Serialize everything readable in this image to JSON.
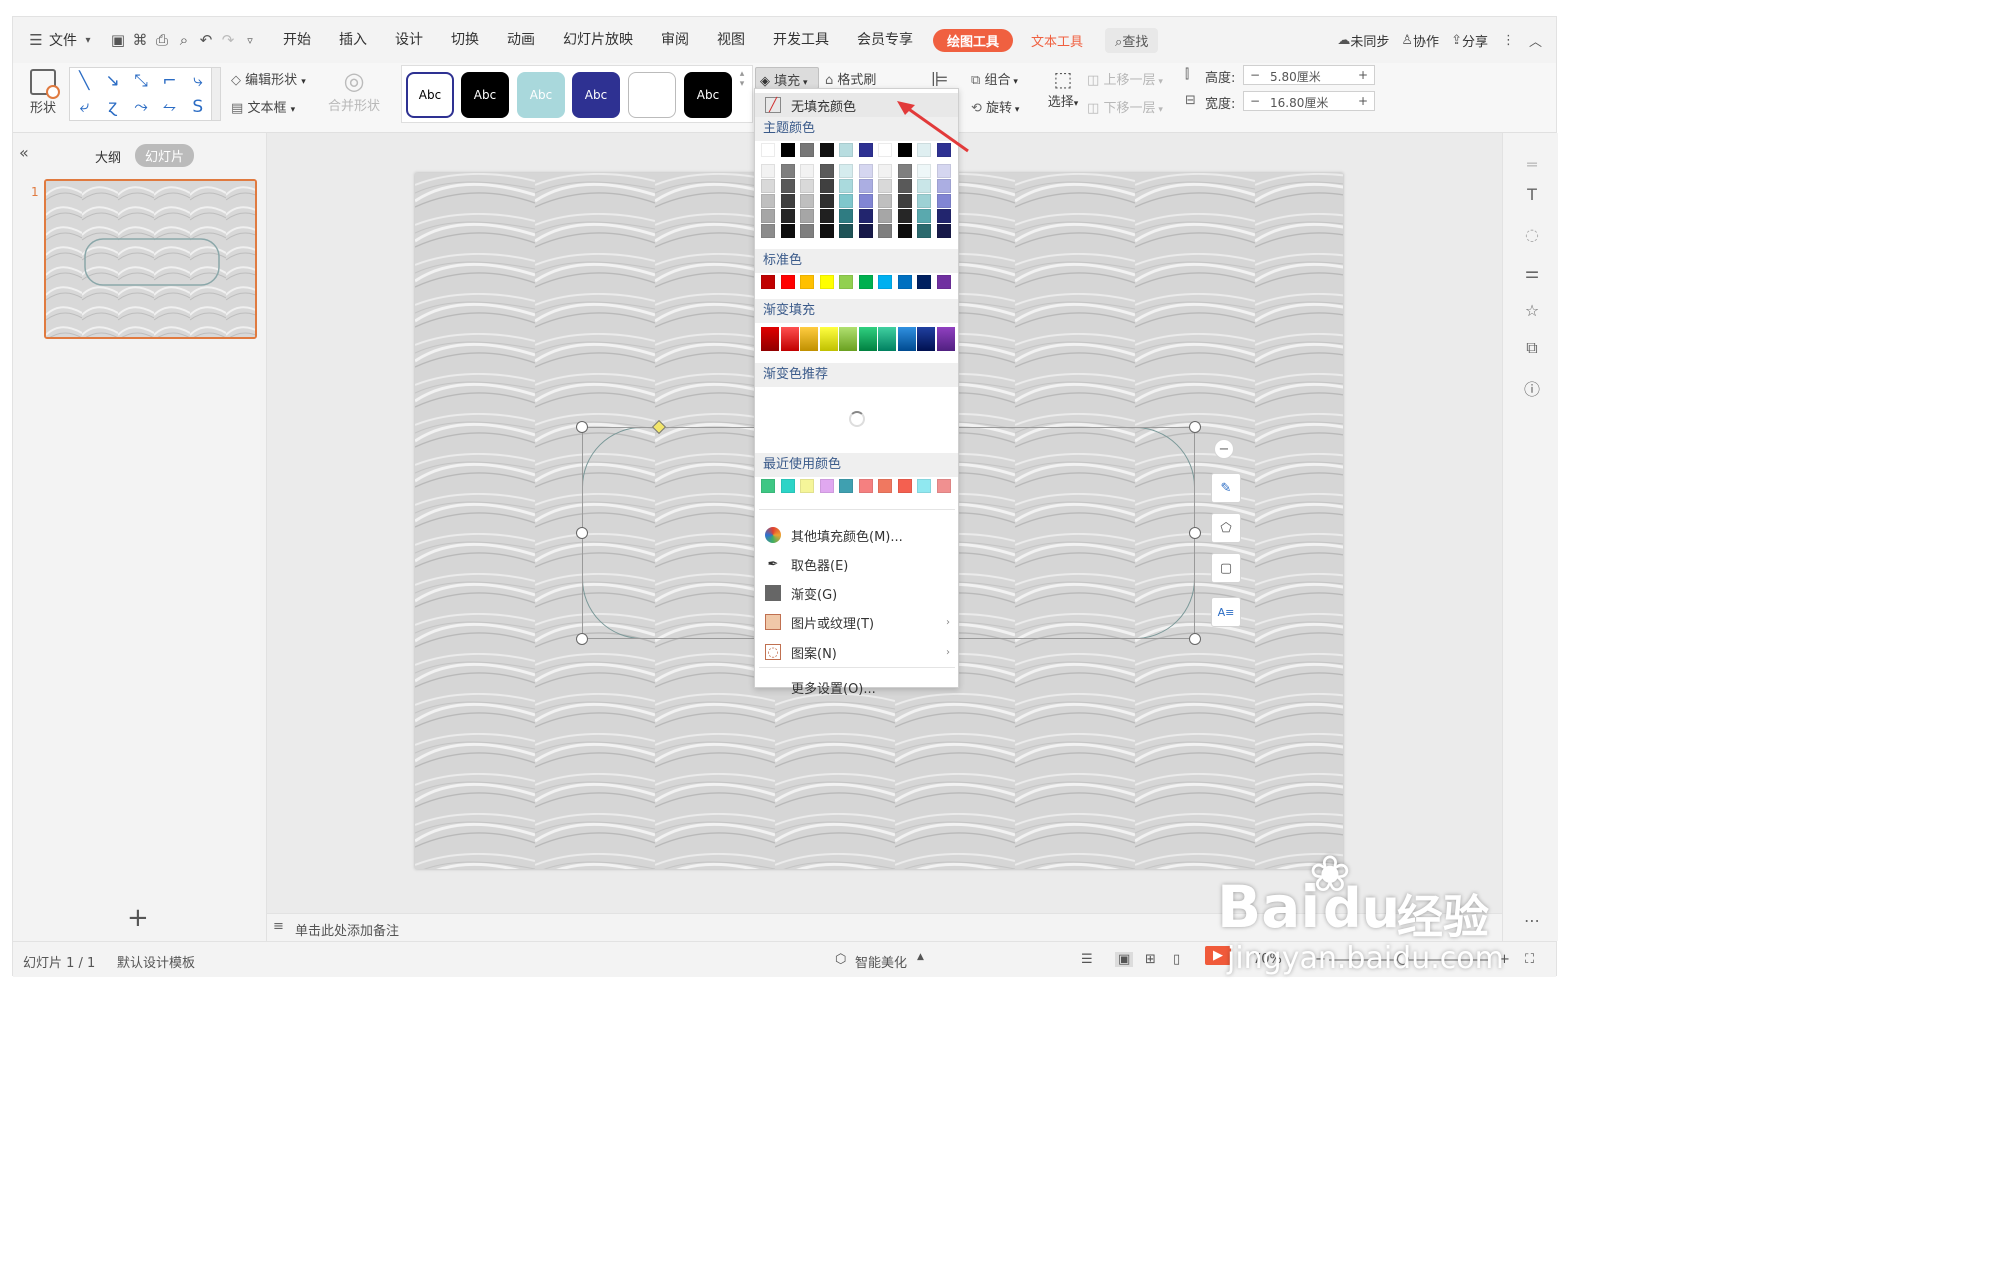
{
  "menubar": {
    "file": "文件",
    "tabs": [
      "开始",
      "插入",
      "设计",
      "切换",
      "动画",
      "幻灯片放映",
      "审阅",
      "视图",
      "开发工具",
      "会员专享"
    ],
    "drawing_tools": "绘图工具",
    "text_tools": "文本工具",
    "search": "查找",
    "sync": "未同步",
    "collab": "协作",
    "share": "分享"
  },
  "ribbon": {
    "shape": "形状",
    "edit_shape": "编辑形状",
    "text_box": "文本框",
    "merge_shapes": "合并形状",
    "style_presets": [
      "Abc",
      "Abc",
      "Abc",
      "Abc",
      "",
      "Abc"
    ],
    "fill": "填充",
    "format_painter": "格式刷",
    "group": "组合",
    "rotate": "旋转",
    "select": "选择",
    "bring_forward": "上移一层",
    "send_backward": "下移一层",
    "height_label": "高度:",
    "height_value": "5.80厘米",
    "width_label": "宽度:",
    "width_value": "16.80厘米"
  },
  "fill_menu": {
    "no_fill": "无填充颜色",
    "theme_colors": "主题颜色",
    "standard_colors": "标准色",
    "gradient_fill": "渐变填充",
    "gradient_recommend": "渐变色推荐",
    "recent_colors": "最近使用颜色",
    "more_fill": "其他填充颜色(M)...",
    "eyedropper": "取色器(E)",
    "gradient": "渐变(G)",
    "picture_texture": "图片或纹理(T)",
    "pattern": "图案(N)",
    "more_settings": "更多设置(O)...",
    "theme_top": [
      "#ffffff",
      "#000000",
      "#777777",
      "#111111",
      "#b8dde0",
      "#2e3192",
      "#ffffff",
      "#000000",
      "#dfeff1",
      "#2e3192"
    ],
    "theme_cols": [
      [
        "#f2f2f2",
        "#d9d9d9",
        "#bfbfbf",
        "#a6a6a6",
        "#8c8c8c"
      ],
      [
        "#7f7f7f",
        "#595959",
        "#3f3f3f",
        "#262626",
        "#0d0d0d"
      ],
      [
        "#f2f2f2",
        "#d9d9d9",
        "#bfbfbf",
        "#a6a6a6",
        "#7f7f7f"
      ],
      [
        "#5a5a5a",
        "#404040",
        "#303030",
        "#202020",
        "#101010"
      ],
      [
        "#d5ecee",
        "#aadadd",
        "#7fc7cc",
        "#2f7c82",
        "#1f5357"
      ],
      [
        "#d5d6f0",
        "#abaee2",
        "#8185d3",
        "#22256e",
        "#171949"
      ],
      [
        "#f2f2f2",
        "#d9d9d9",
        "#bfbfbf",
        "#a6a6a6",
        "#7f7f7f"
      ],
      [
        "#7f7f7f",
        "#595959",
        "#3f3f3f",
        "#262626",
        "#0d0d0d"
      ],
      [
        "#eef7f8",
        "#c9e6e8",
        "#9dd1d4",
        "#5aa9ae",
        "#2c6a6e"
      ],
      [
        "#d5d6f0",
        "#abaee2",
        "#8185d3",
        "#22256e",
        "#171949"
      ]
    ],
    "standard": [
      "#c00000",
      "#ff0000",
      "#ffc000",
      "#ffff00",
      "#92d050",
      "#00b050",
      "#00b0f0",
      "#0070c0",
      "#002060",
      "#7030a0"
    ],
    "gradients": [
      [
        "#e00000",
        "#900000"
      ],
      [
        "#ff5050",
        "#c00000"
      ],
      [
        "#ffcc40",
        "#c09000"
      ],
      [
        "#ffff40",
        "#c0c000"
      ],
      [
        "#b0e070",
        "#6aa020"
      ],
      [
        "#30d080",
        "#008040"
      ],
      [
        "#40d0a0",
        "#008060"
      ],
      [
        "#3090e0",
        "#004a90"
      ],
      [
        "#2040a0",
        "#001050"
      ],
      [
        "#9040c0",
        "#502080"
      ]
    ],
    "recent": [
      "#3ec784",
      "#2cd4c7",
      "#f5f599",
      "#e0a8f0",
      "#3fa0b0",
      "#f58080",
      "#f07860",
      "#f46050",
      "#90e8f0",
      "#f09090"
    ]
  },
  "left_panel": {
    "outline": "大纲",
    "slides": "幻灯片",
    "slide_number": "1",
    "add": "+"
  },
  "notes": {
    "placeholder": "单击此处添加备注"
  },
  "status": {
    "slide_info": "幻灯片 1 / 1",
    "template": "默认设计模板",
    "beautify": "智能美化",
    "zoom": "70%"
  },
  "watermark": {
    "logo_text": "Bai",
    "logo_text2": "du",
    "cn": "经验",
    "url": "jingyan.baidu.com"
  }
}
